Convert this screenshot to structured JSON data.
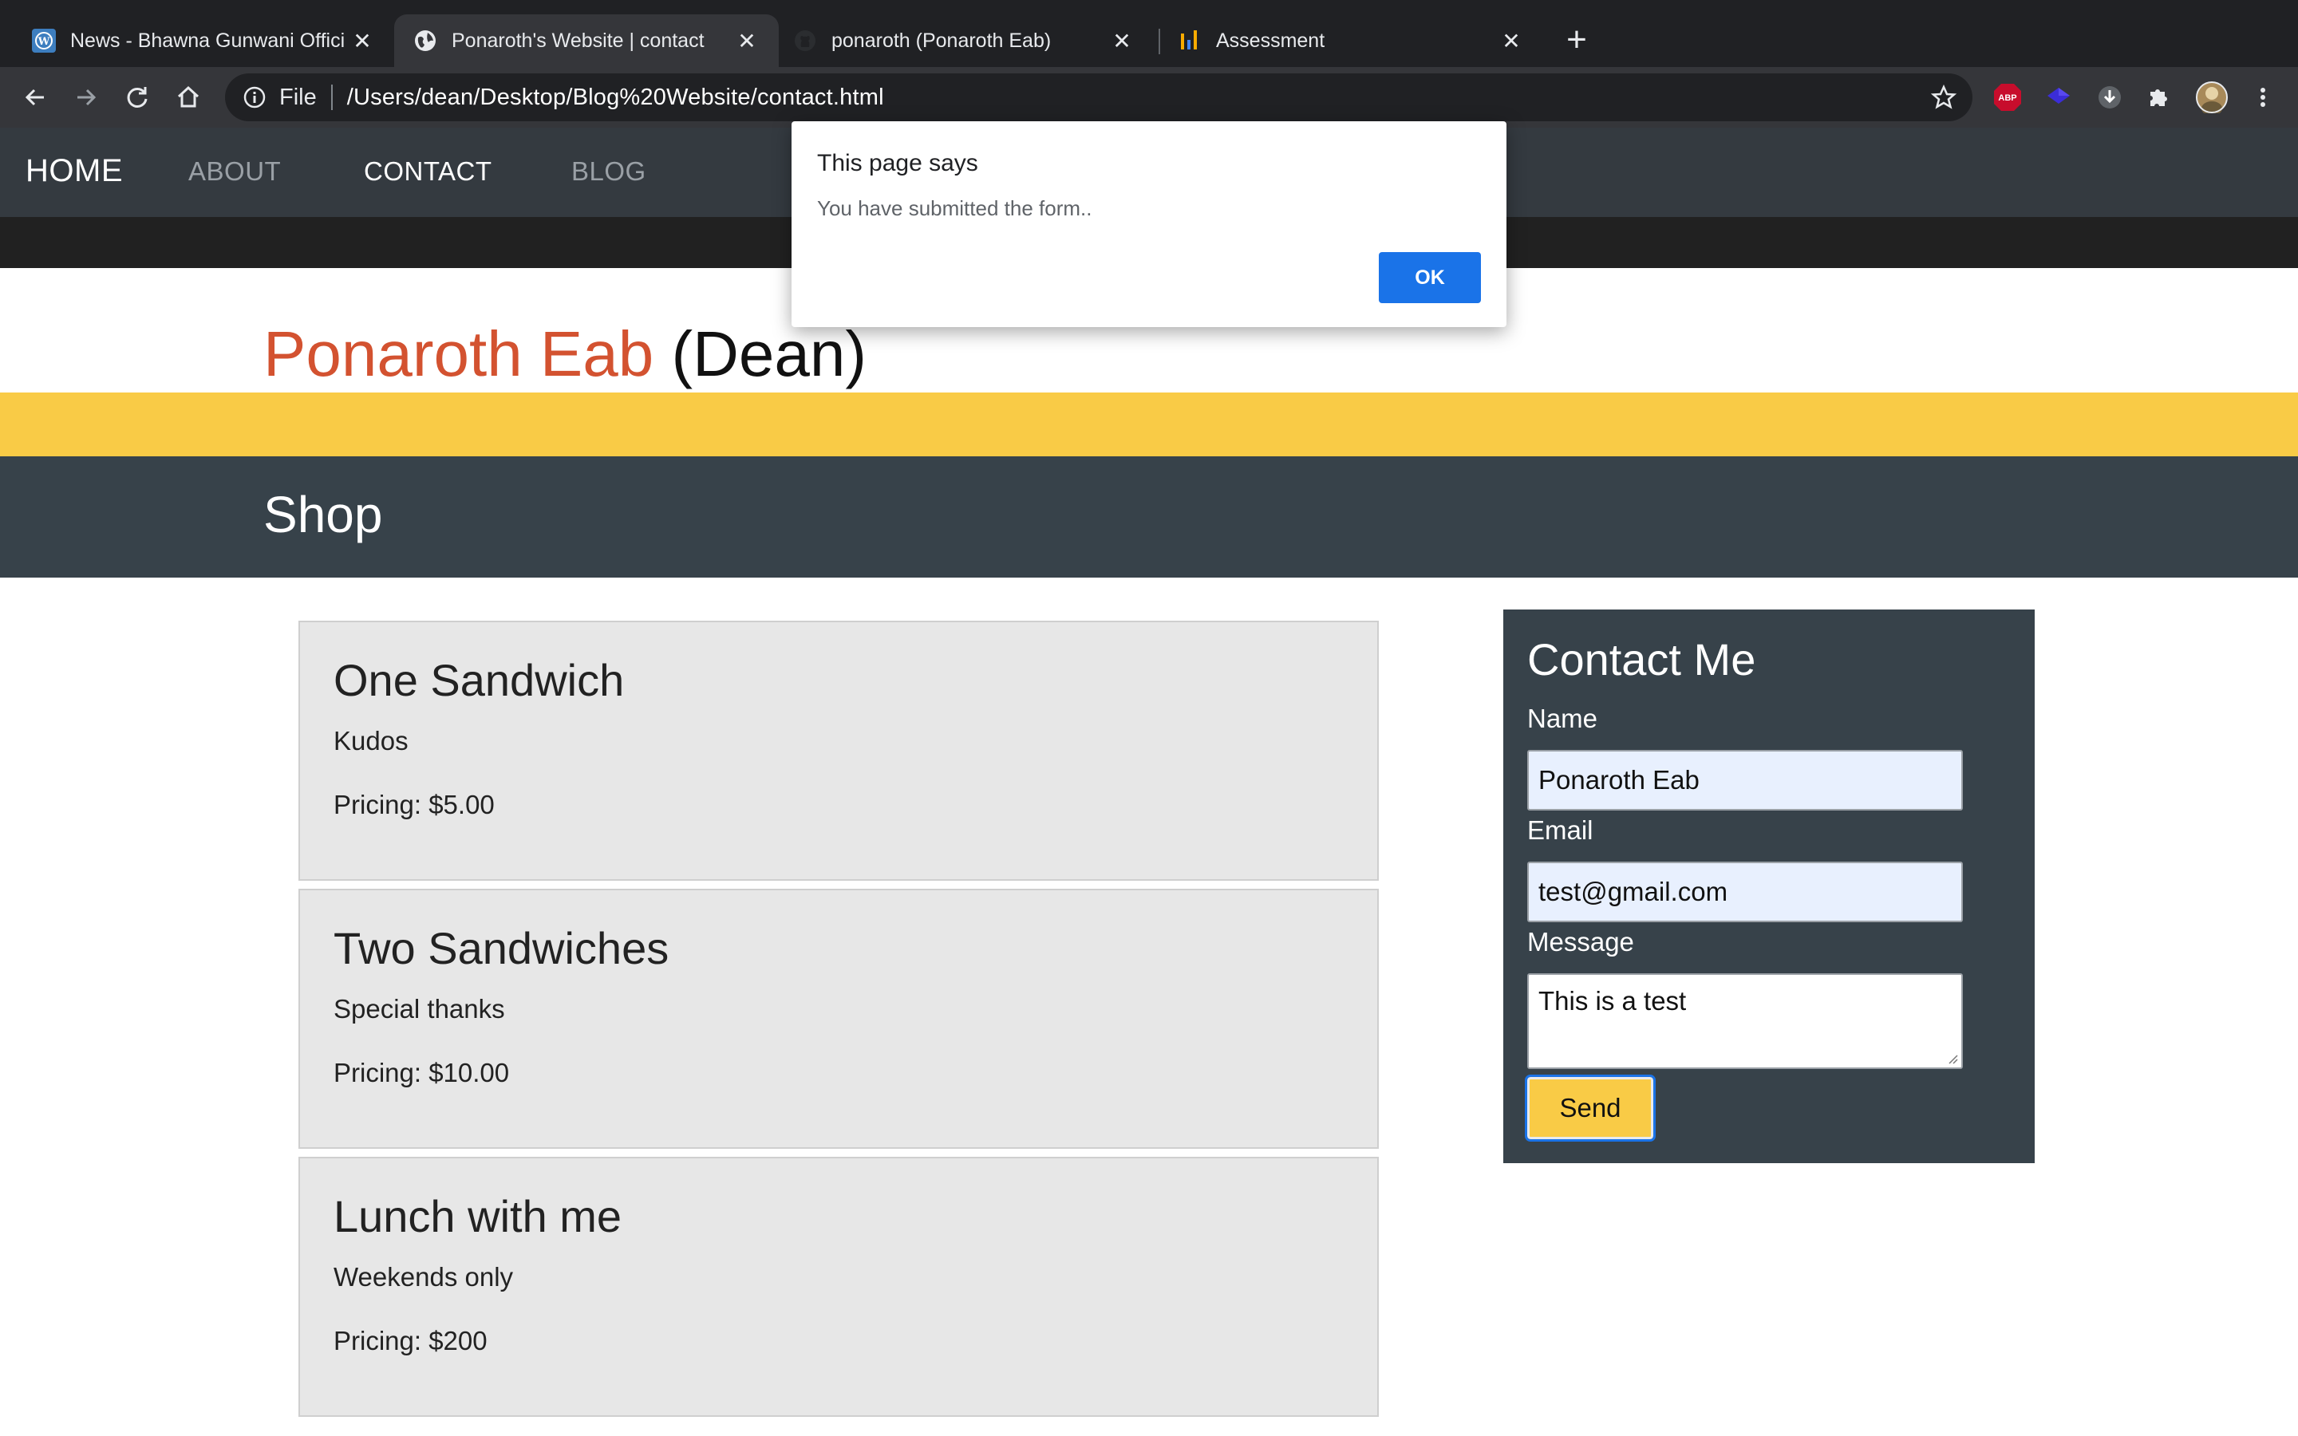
{
  "browser": {
    "tabs": [
      {
        "title": "News - Bhawna Gunwani Offici",
        "icon": "wordpress-icon"
      },
      {
        "title": "Ponaroth's Website | contact",
        "icon": "globe-icon",
        "active": true
      },
      {
        "title": "ponaroth (Ponaroth Eab)",
        "icon": "github-icon"
      },
      {
        "title": "Assessment",
        "icon": "bar-chart-icon"
      }
    ],
    "url_scheme": "File",
    "url": "/Users/dean/Desktop/Blog%20Website/contact.html",
    "extensions": [
      "adblock-plus-icon",
      "diamond-extension-icon",
      "download-icon",
      "puzzle-icon",
      "avatar"
    ],
    "abp_label": "ABP"
  },
  "nav": {
    "brand": "HOME",
    "items": [
      "ABOUT",
      "CONTACT",
      "BLOG"
    ],
    "active": "CONTACT"
  },
  "hero": {
    "name": "Ponaroth Eab",
    "nickname": " (Dean)",
    "accent_color": "#d35230"
  },
  "shop": {
    "title": "Shop",
    "items": [
      {
        "name": "One Sandwich",
        "subtitle": "Kudos",
        "price": "Pricing: $5.00"
      },
      {
        "name": "Two Sandwiches",
        "subtitle": "Special thanks",
        "price": "Pricing: $10.00"
      },
      {
        "name": "Lunch with me",
        "subtitle": "Weekends only",
        "price": "Pricing: $200"
      }
    ]
  },
  "contact": {
    "title": "Contact Me",
    "name_label": "Name",
    "name_value": "Ponaroth Eab",
    "email_label": "Email",
    "email_value": "test@gmail.com",
    "message_label": "Message",
    "message_value": "This is a test",
    "send_label": "Send"
  },
  "dialog": {
    "title": "This page says",
    "message": "You have submitted the form..",
    "ok_label": "OK"
  },
  "colors": {
    "nav_bg": "#343a40",
    "yellow": "#f9cb46",
    "panel_bg": "#37424a",
    "primary_blue": "#1a73e8"
  }
}
